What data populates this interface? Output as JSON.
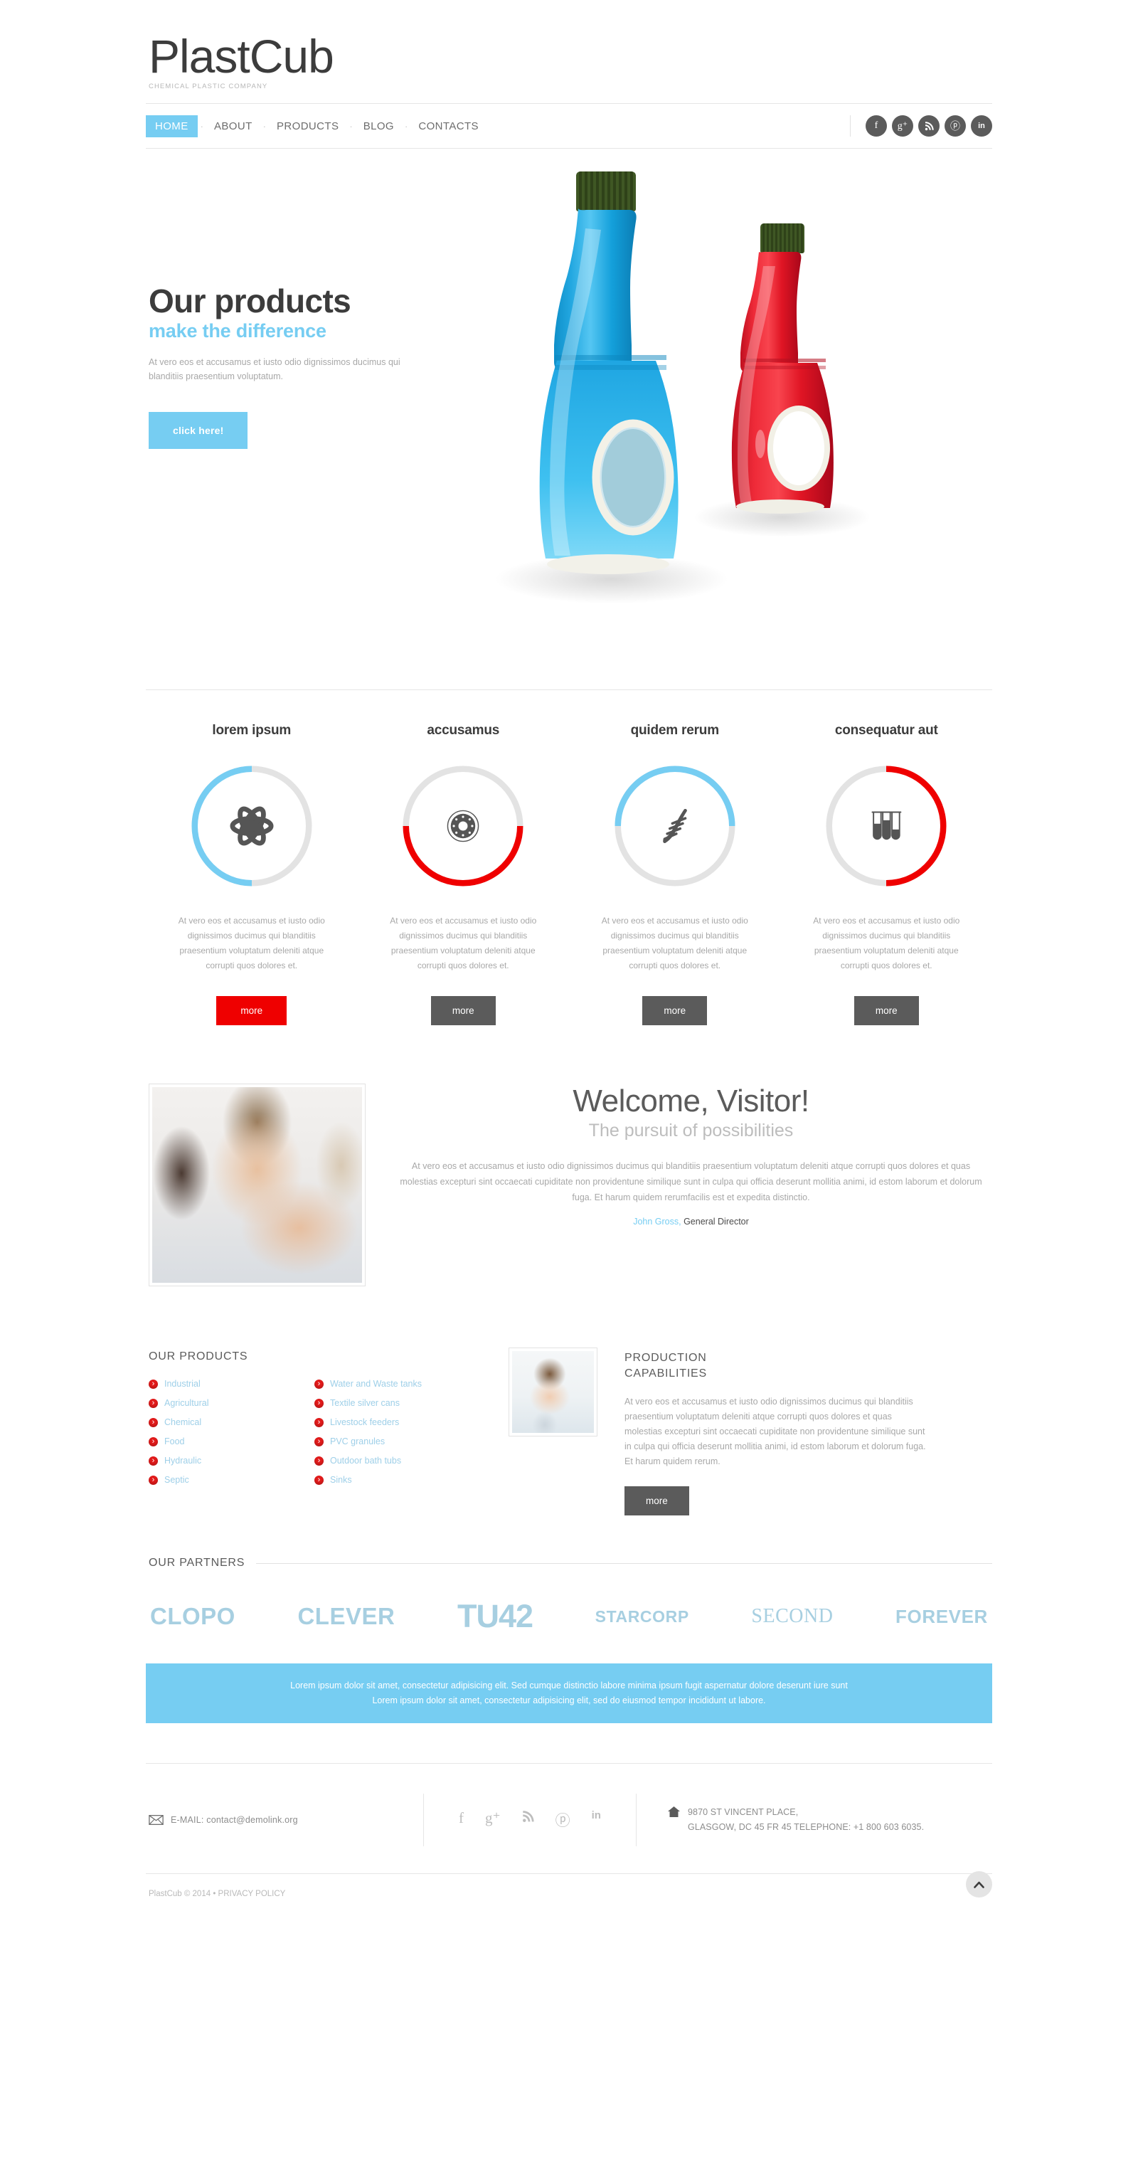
{
  "header": {
    "logo_title": "PlastCub",
    "logo_tagline": "CHEMICAL PLASTIC COMPANY"
  },
  "nav": {
    "items": [
      {
        "label": "HOME",
        "active": true,
        "dropdown": false
      },
      {
        "label": "ABOUT",
        "active": false,
        "dropdown": true
      },
      {
        "label": "PRODUCTS",
        "active": false,
        "dropdown": false
      },
      {
        "label": "BLOG",
        "active": false,
        "dropdown": false
      },
      {
        "label": "CONTACTS",
        "active": false,
        "dropdown": false
      }
    ],
    "separator": "·",
    "socials": [
      {
        "name": "facebook-icon",
        "glyph": "f"
      },
      {
        "name": "google-plus-icon",
        "glyph": "g⁺"
      },
      {
        "name": "rss-icon",
        "glyph": "ᴰ"
      },
      {
        "name": "pinterest-icon",
        "glyph": "ⓟ"
      },
      {
        "name": "linkedin-icon",
        "glyph": "in"
      }
    ]
  },
  "hero": {
    "heading": "Our products",
    "subheading": "make the difference",
    "paragraph": "At vero eos et accusamus et iusto odio dignissimos ducimus qui blanditiis praesentium voluptatum.",
    "button": "click here!",
    "image_alt": "Two plastic detergent bottles, blue and red, with dark green caps"
  },
  "services": [
    {
      "title": "lorem ipsum",
      "icon": "atom-icon",
      "arc_color": "#76cdf2",
      "arc_track": "#e3e3e3",
      "arc_from": 180,
      "arc_to": 360,
      "description": "At vero eos et accusamus et iusto odio dignissimos ducimus qui blanditiis praesentium voluptatum deleniti atque corrupti quos dolores et.",
      "button": "more",
      "button_variant": "hot"
    },
    {
      "title": "accusamus",
      "icon": "wheel-disc-icon",
      "arc_color": "#ef0000",
      "arc_track": "#e3e3e3",
      "arc_from": 90,
      "arc_to": 270,
      "description": "At vero eos et accusamus et iusto odio dignissimos ducimus qui blanditiis praesentium voluptatum deleniti atque corrupti quos dolores et.",
      "button": "more",
      "button_variant": "dark"
    },
    {
      "title": "quidem rerum",
      "icon": "dna-icon",
      "arc_color": "#76cdf2",
      "arc_track": "#e3e3e3",
      "arc_from": 270,
      "arc_to": 450,
      "description": "At vero eos et accusamus et iusto odio dignissimos ducimus qui blanditiis praesentium voluptatum deleniti atque corrupti quos dolores et.",
      "button": "more",
      "button_variant": "dark"
    },
    {
      "title": "consequatur aut",
      "icon": "test-tubes-icon",
      "arc_color": "#ef0000",
      "arc_track": "#e3e3e3",
      "arc_from": 0,
      "arc_to": 180,
      "description": "At vero eos et accusamus et iusto odio dignissimos ducimus qui blanditiis praesentium voluptatum deleniti atque corrupti quos dolores et.",
      "button": "more",
      "button_variant": "dark"
    }
  ],
  "welcome": {
    "heading": "Welcome, Visitor!",
    "subheading": "The pursuit of possibilities",
    "paragraph": "At vero eos et accusamus et iusto odio dignissimos ducimus qui blanditiis praesentium voluptatum deleniti atque corrupti quos dolores et quas molestias excepturi sint occaecati cupiditate non providentune similique sunt in culpa qui officia deserunt mollitia animi, id estom laborum et dolorum fuga. Et harum quidem rerumfacilis est et expedita distinctio.",
    "signature_name": "John Gross,",
    "signature_role": "General Director",
    "image_alt": "Smiling businessman in striped shirt"
  },
  "products": {
    "title": "OUR PRODUCTS",
    "column_left": [
      "Industrial",
      "Agricultural",
      "Chemical",
      "Food",
      "Hydraulic",
      "Septic"
    ],
    "column_right": [
      "Water and Waste tanks",
      "Textile silver cans",
      "Livestock feeders",
      "PVC granules",
      "Outdoor bath tubs",
      "Sinks"
    ]
  },
  "capabilities": {
    "title_line1": "PRODUCTION",
    "title_line2": "CAPABILITIES",
    "paragraph": "At vero eos et accusamus et iusto odio dignissimos ducimus qui blanditiis praesentium voluptatum deleniti atque corrupti quos dolores et quas molestias excepturi sint occaecati cupiditate non providentune similique sunt in culpa qui officia deserunt mollitia animi, id estom laborum et dolorum fuga. Et harum quidem rerum.",
    "button": "more",
    "image_alt": "Young woman looking up thoughtfully"
  },
  "partners": {
    "title": "OUR PARTNERS",
    "logos": [
      "CLOPO",
      "CLEVER",
      "TU42",
      "STARCORP",
      "SECOND",
      "FOREVER"
    ],
    "color": "#a7cfe1"
  },
  "banner": {
    "line1": "Lorem ipsum dolor sit amet, consectetur adipisicing elit. Sed cumque distinctio labore minima ipsum fugit aspernatur dolore deserunt iure sunt",
    "line2": "Lorem ipsum dolor sit amet, consectetur adipisicing elit, sed do eiusmod tempor incididunt ut labore.",
    "background": "#76cdf2"
  },
  "footer": {
    "email_label": "E-MAIL:",
    "email": "contact@demolink.org",
    "socials": [
      {
        "name": "facebook-icon",
        "glyph": "f"
      },
      {
        "name": "google-plus-icon",
        "glyph": "g⁺"
      },
      {
        "name": "rss-icon",
        "glyph": "ᴰ"
      },
      {
        "name": "pinterest-icon",
        "glyph": "ⓟ"
      },
      {
        "name": "linkedin-icon",
        "glyph": "in"
      }
    ],
    "address_line1": "9870 ST VINCENT PLACE,",
    "address_line2": "GLASGOW, DC 45 FR 45 TELEPHONE: +1 800 603 6035."
  },
  "copyright": {
    "text": "PlastCub © 2014",
    "separator": "•",
    "privacy": "PRIVACY POLICY",
    "totop": "scroll to top"
  },
  "colors": {
    "accent_blue": "#76cdf2",
    "accent_red": "#ef0000",
    "dark_gray": "#5b5b5b",
    "text_gray": "#a8a8a8",
    "partner_blue": "#a7cfe1"
  }
}
